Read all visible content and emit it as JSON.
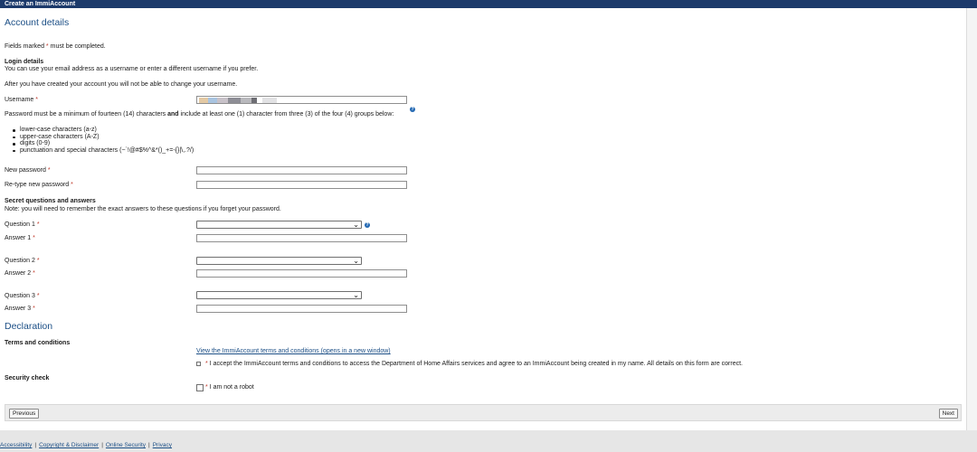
{
  "header": {
    "title": "Create an ImmiAccount"
  },
  "page": {
    "heading": "Account details",
    "required_prefix": "Fields marked",
    "required_suffix": "must be completed.",
    "asterisk": "*"
  },
  "login": {
    "heading": "Login details",
    "intro": "You can use your email address as a username or enter a different username if you prefer.",
    "note": "After you have created your account you will not be able to change your username.",
    "username_label": "Username",
    "password_rule_start": "Password must be a minimum of fourteen (14) characters",
    "password_rule_and": "and",
    "password_rule_end": "include at least one (1) character from three (3) of the four (4) groups below:",
    "groups": [
      "lower-case characters (a-z)",
      "upper-case characters (A-Z)",
      "digits (0-9)",
      "punctuation and special characters (~`!@#$%^&*()_+=-{}|\\,.?/)"
    ],
    "new_password_label": "New password",
    "retype_password_label": "Re-type new password"
  },
  "secret": {
    "heading": "Secret questions and answers",
    "note": "Note: you will need to remember the exact answers to these questions if you forget your password.",
    "q1_label": "Question 1",
    "a1_label": "Answer 1",
    "q2_label": "Question 2",
    "a2_label": "Answer 2",
    "q3_label": "Question 3",
    "a3_label": "Answer 3"
  },
  "declaration": {
    "heading": "Declaration",
    "terms_heading": "Terms and conditions",
    "terms_link": "View the ImmiAccount terms and conditions (opens in a new window)",
    "accept_text": "I accept the ImmiAccount terms and conditions to access the Department of Home Affairs services and agree to an ImmiAccount being created in my name. All details on this form are correct.",
    "security_heading": "Security check",
    "robot_text": "I am not a robot"
  },
  "nav": {
    "previous": "Previous",
    "next": "Next"
  },
  "footer": {
    "links": [
      "Accessibility",
      "Copyright & Disclaimer",
      "Online Security",
      "Privacy"
    ],
    "separator": "|"
  },
  "icons": {
    "help": "help-icon",
    "chevron": "chevron-down-icon"
  },
  "colors": {
    "header_bg": "#1c3a6b",
    "heading": "#1c4f86",
    "required": "#c0392b"
  }
}
